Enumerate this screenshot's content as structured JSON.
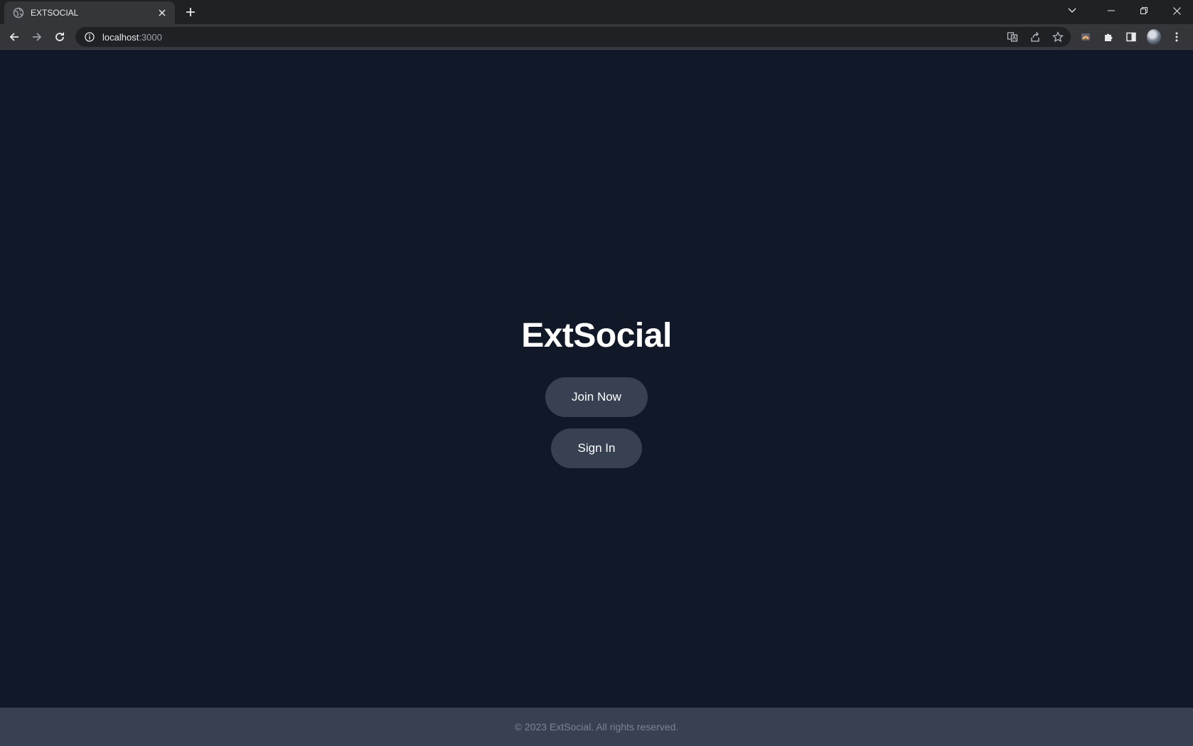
{
  "browser": {
    "tab": {
      "title": "EXTSOCIAL"
    },
    "address_bar": {
      "host": "localhost",
      "port": ":3000"
    }
  },
  "page": {
    "brand": "ExtSocial",
    "buttons": {
      "join": "Join Now",
      "signin": "Sign In"
    },
    "footer": "© 2023 ExtSocial. All rights reserved."
  },
  "colors": {
    "page_background": "#111827",
    "button_background": "#374151",
    "footer_background": "#374151"
  }
}
